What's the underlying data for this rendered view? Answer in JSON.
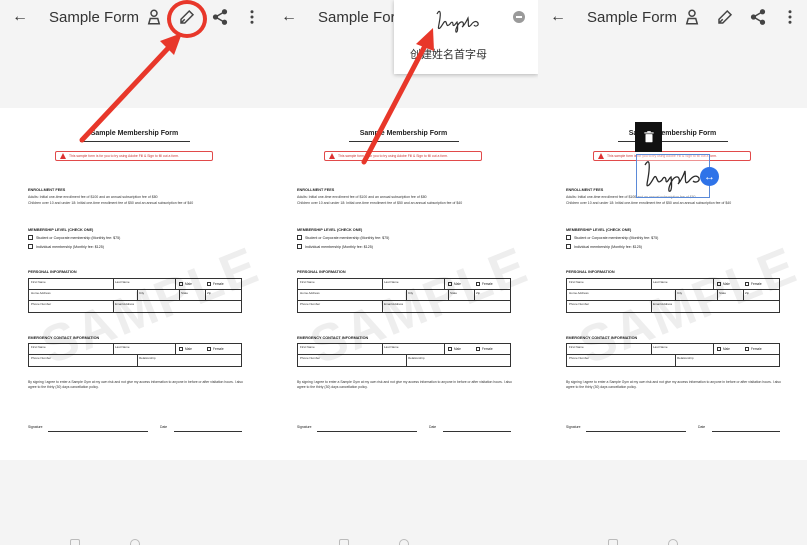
{
  "topbar": {
    "title": "Sample Form",
    "back_icon": "arrow-left-icon",
    "icons": [
      "person-icon",
      "pen-icon",
      "share-icon",
      "more-vert-icon"
    ]
  },
  "form": {
    "title": "Sample Membership Form",
    "notice": "This sample form is for you to try using Adobe Fill & Sign to fill out a form.",
    "enrollment": {
      "heading": "ENROLLMENT FEES",
      "line1": "Adults: Initial one-time enrollment fee of $100 and an annual subscription fee of $80",
      "line2": "Children over 10 and under 18: Initial one-time enrollment fee of $50 and an annual subscription fee of $40"
    },
    "membership": {
      "heading": "MEMBERSHIP LEVEL (CHECK ONE)",
      "option1": "Student or Corporate membership (Monthly fee: $75)",
      "option2": "Individual membership (Monthly fee: $125)"
    },
    "personal": {
      "heading": "PERSONAL INFORMATION",
      "first_name": "First Name",
      "last_name": "Last Name",
      "male": "Male",
      "female": "Female",
      "home_address": "Home Address",
      "city": "City",
      "state": "State",
      "zip": "Zip",
      "phone": "Phone Number",
      "email": "Email Address"
    },
    "emergency": {
      "heading": "EMERGENCY CONTACT INFORMATION",
      "first_name": "First Name",
      "last_name": "Last Name",
      "male": "Male",
      "female": "Female",
      "phone": "Phone Number",
      "relationship": "Relationship"
    },
    "agreement": "By signing I agree to enter a Sample Gym at my own risk and not give my access information to anyone in before or after visitation hours. I also agree to the thirty (30) days cancellation policy.",
    "signature_label": "Signature",
    "date_label": "Date",
    "watermark": "SAMPLE"
  },
  "dropdown": {
    "create_initials": "创建姓名首字母",
    "remove_icon": "remove-circle-icon"
  },
  "annotations": {
    "highlight_color": "#e8372a",
    "handle_color": "#2f73e8"
  }
}
